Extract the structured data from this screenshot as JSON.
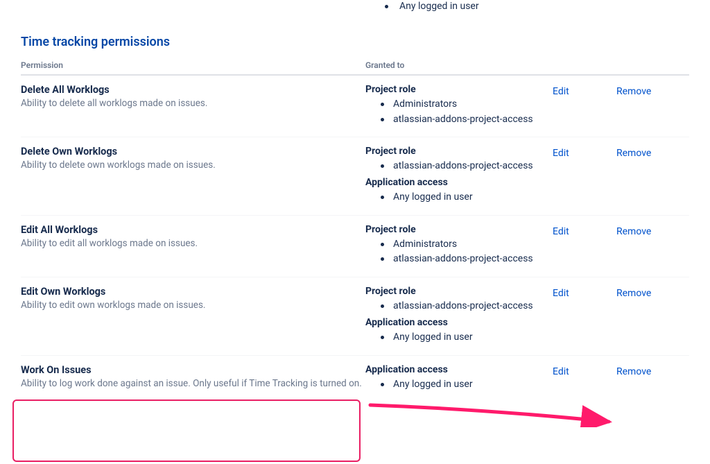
{
  "top_fragment": "Any logged in user",
  "section_title": "Time tracking permissions",
  "headers": {
    "permission": "Permission",
    "granted_to": "Granted to"
  },
  "actions": {
    "edit": "Edit",
    "remove": "Remove"
  },
  "rows": [
    {
      "name": "Delete All Worklogs",
      "desc": "Ability to delete all worklogs made on issues.",
      "grants": [
        {
          "label": "Project role",
          "items": [
            "Administrators",
            "atlassian-addons-project-access"
          ]
        }
      ]
    },
    {
      "name": "Delete Own Worklogs",
      "desc": "Ability to delete own worklogs made on issues.",
      "grants": [
        {
          "label": "Project role",
          "items": [
            "atlassian-addons-project-access"
          ]
        },
        {
          "label": "Application access",
          "items": [
            "Any logged in user"
          ]
        }
      ]
    },
    {
      "name": "Edit All Worklogs",
      "desc": "Ability to edit all worklogs made on issues.",
      "grants": [
        {
          "label": "Project role",
          "items": [
            "Administrators",
            "atlassian-addons-project-access"
          ]
        }
      ]
    },
    {
      "name": "Edit Own Worklogs",
      "desc": "Ability to edit own worklogs made on issues.",
      "grants": [
        {
          "label": "Project role",
          "items": [
            "atlassian-addons-project-access"
          ]
        },
        {
          "label": "Application access",
          "items": [
            "Any logged in user"
          ]
        }
      ]
    },
    {
      "name": "Work On Issues",
      "desc": "Ability to log work done against an issue. Only useful if Time Tracking is turned on.",
      "grants": [
        {
          "label": "Application access",
          "items": [
            "Any logged in user"
          ]
        }
      ]
    }
  ]
}
